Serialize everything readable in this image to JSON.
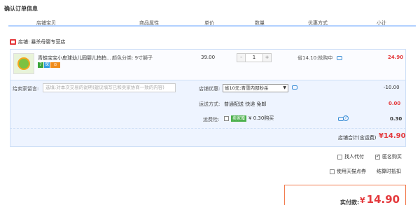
{
  "page": {
    "title": "确认订单信息"
  },
  "columns": [
    "店铺宝贝",
    "商品属性",
    "单价",
    "数量",
    "优惠方式",
    "小计"
  ],
  "shop": {
    "label": "店铺:",
    "name": "暴杀母婴专营店"
  },
  "item": {
    "name": "青蛙宝宝小皮球幼儿园婴儿拍拍...",
    "attribute": "颜色分类: 9寸獅子",
    "price": "39.00",
    "quantity": "1",
    "qty_minus": "-",
    "qty_plus": "+",
    "promo": "省14.10:抢购中",
    "subtotal": "24.90",
    "badges": [
      "7",
      "保",
      "⊙"
    ]
  },
  "options": {
    "message_label": "给卖家留言:",
    "message_placeholder": "选填:对本次交易的说明(建议填写已和卖家协商一致的内容)",
    "discount_label": "店铺优惠:",
    "discount_select": "省10元:青雪内部秒杀",
    "discount_value": "-10.00",
    "shipping_label": "运送方式:",
    "shipping_value": "普通配送 快递 免邮",
    "shipping_price": "0.00",
    "insurance_label": "运费险:",
    "insurance_tag": "卖家赠",
    "insurance_text": "¥ 0.30购买",
    "insurance_price": "0.30"
  },
  "shop_total": {
    "label": "店铺合计(含运费)",
    "value": "¥14.90"
  },
  "bottom": {
    "proxy_pay": "找人代付",
    "anonymous": "匿名购买",
    "tmall_coupon": "使用天猫点券",
    "settle_discount": "结算时抵扣"
  },
  "final": {
    "label": "实付款:",
    "currency": "¥",
    "value": "14.90"
  },
  "colors": {
    "accent": "#e4393c",
    "border": "#cfe0f7",
    "panel": "#eef4ff",
    "final_border": "#f27b4e"
  }
}
